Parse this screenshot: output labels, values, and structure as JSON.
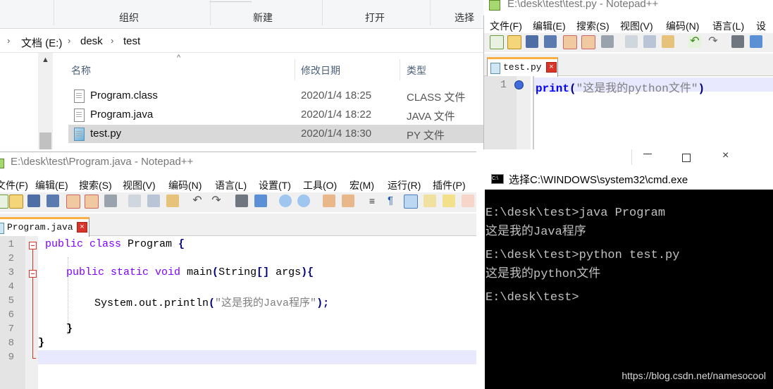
{
  "explorer": {
    "ribbon": {
      "organize": "组织",
      "new": "新建",
      "open": "打开",
      "select": "选择"
    },
    "breadcrumb": [
      {
        "text": "文档 (E:)"
      },
      {
        "text": "desk"
      },
      {
        "text": "test"
      }
    ],
    "breadcrumb_partial": "i",
    "columns": {
      "name": "名称",
      "modified": "修改日期",
      "type": "类型"
    },
    "files": [
      {
        "name": "Program.class",
        "modified": "2020/1/4 18:25",
        "type": "CLASS 文件",
        "icon": "file-icon",
        "selected": false
      },
      {
        "name": "Program.java",
        "modified": "2020/1/4 18:22",
        "type": "JAVA 文件",
        "icon": "file-icon",
        "selected": false
      },
      {
        "name": "test.py",
        "modified": "2020/1/4 18:30",
        "type": "PY 文件",
        "icon": "python-file-icon",
        "selected": true
      }
    ]
  },
  "notepad_py": {
    "title": "E:\\desk\\test\\test.py - Notepad++",
    "menu": [
      "文件(F)",
      "编辑(E)",
      "搜索(S)",
      "视图(V)",
      "编码(N)",
      "语言(L)",
      "设置"
    ],
    "tab": "test.py",
    "line_numbers": [
      "1"
    ],
    "code": {
      "keyword": "print",
      "open": "(",
      "string": "\"这是我的python文件\"",
      "close": ")"
    }
  },
  "notepad_java": {
    "title": "E:\\desk\\test\\Program.java - Notepad++",
    "menu": [
      "文件(F)",
      "编辑(E)",
      "搜索(S)",
      "视图(V)",
      "编码(N)",
      "语言(L)",
      "设置(T)",
      "工具(O)",
      "宏(M)",
      "运行(R)",
      "插件(P)",
      "窗"
    ],
    "tab": "Program.java",
    "line_numbers": [
      "1",
      "2",
      "3",
      "4",
      "5",
      "6",
      "7",
      "8",
      "9"
    ],
    "code": {
      "l1_kw": "public class",
      "l1_rest": " Program ",
      "l1_brace": "{",
      "l3_kw": "public static void",
      "l3_rest": " main",
      "l3_paren": "(",
      "l3_args": "String",
      "l3_br": "[]",
      "l3_args2": " args",
      "l3_close": "){",
      "l5_rest": "System.out.println",
      "l5_paren": "(",
      "l5_str": "\"这是我的Java程序\"",
      "l5_close": ");",
      "l7_brace": "}",
      "l8_brace": "}"
    }
  },
  "cmd": {
    "title": "选择C:\\WINDOWS\\system32\\cmd.exe",
    "lines": [
      "E:\\desk\\test>java Program",
      "这是我的Java程序",
      "",
      "E:\\desk\\test>python test.py",
      "这是我的python文件",
      "",
      "E:\\desk\\test>"
    ],
    "watermark": "https://blog.csdn.net/namesocool"
  },
  "colors": {
    "tab_accent": "#fbae41",
    "keyword": "#8000ff",
    "keyword_blue": "#0000ff",
    "string": "#808080",
    "current_line": "#e8e8ff"
  }
}
